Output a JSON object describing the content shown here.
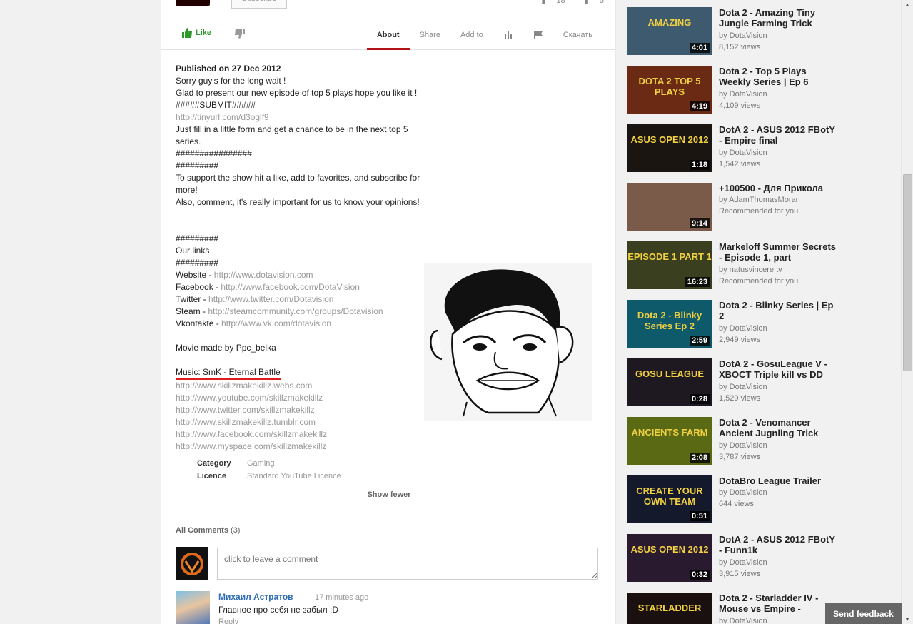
{
  "top": {
    "subscribe_label": "Subscribe",
    "likes_count": "18",
    "dislikes_count": "5"
  },
  "actions": {
    "like_label": "Like",
    "tabs": [
      {
        "label": "About",
        "active": true
      },
      {
        "label": "Share"
      },
      {
        "label": "Add to"
      },
      {
        "icon": "stats-icon"
      },
      {
        "icon": "flag-icon"
      },
      {
        "label": "Скачать"
      }
    ]
  },
  "description": {
    "published": "Published on 27 Dec 2012",
    "lines": [
      {
        "text": "Sorry guy's for the long wait !"
      },
      {
        "text": "Glad to present our new episode of top 5 plays hope you like it !"
      },
      {
        "text": "#####SUBMIT#####"
      },
      {
        "link": "http://tinyurl.com/d3oglf9"
      },
      {
        "text": "Just fill in a little form and get a chance to be in the next top 5"
      },
      {
        "text": "series."
      },
      {
        "text": "################"
      },
      {
        "text": "#########"
      },
      {
        "text": "To support the show hit a like, add to favorites, and subscribe for"
      },
      {
        "text": "more!"
      },
      {
        "text": "Also, comment, it's really important for us to know your opinions!"
      }
    ],
    "hashes_top": "#########",
    "our_links": "Our links",
    "hashes_bottom": "#########",
    "links": [
      {
        "label": "Website - ",
        "url": "http://www.dotavision.com"
      },
      {
        "label": "Facebook - ",
        "url": "http://www.facebook.com/DotaVision"
      },
      {
        "label": "Twitter - ",
        "url": "http://www.twitter.com/Dotavision"
      },
      {
        "label": "Steam - ",
        "url": "http://steamcommunity.com/groups/Dotavision"
      },
      {
        "label": "Vkontakte - ",
        "url": "http://www.vk.com/dotavision"
      }
    ],
    "movie_by": "Movie made by Ppc_belka",
    "music": "Music: SmK - Eternal Battle",
    "music_links": [
      "http://www.skillzmakekillz.webs.com",
      "http://www.youtube.com/skillzmakekillz",
      "http://www.twitter.com/skillzmakekillz",
      "http://www.skillzmakekillz.tumblr.com",
      "http://www.facebook.com/skillzmakekillz",
      "http://www.myspace.com/skillzmakekillz"
    ],
    "category_key": "Category",
    "category_val": "Gaming",
    "licence_key": "Licence",
    "licence_val": "Standard YouTube Licence",
    "show_fewer": "Show fewer"
  },
  "comments": {
    "header": "All Comments",
    "count": "(3)",
    "placeholder": "click to leave a comment",
    "first": {
      "author": "Михаил Астратов",
      "time": "17 minutes ago",
      "text": "Главное про себя не забыл :D",
      "reply": "Reply"
    }
  },
  "sidebar": [
    {
      "title": "Dota 2 - Amazing Tiny Jungle Farming Trick",
      "by": "by DotaVision",
      "meta": "8,152 views",
      "duration": "4:01",
      "thumb_text": "AMAZING",
      "bg": "#3d5a6e"
    },
    {
      "title": "Dota 2 - Top 5 Plays Weekly Series | Ep 6",
      "by": "by DotaVision",
      "meta": "4,109 views",
      "duration": "4:19",
      "thumb_text": "DOTA 2 TOP 5 PLAYS",
      "bg": "#6b2a14"
    },
    {
      "title": "DotA 2 - ASUS 2012 FBotY - Empire final",
      "by": "by DotaVision",
      "meta": "1,542 views",
      "duration": "1:18",
      "thumb_text": "ASUS OPEN 2012",
      "bg": "#1b1512"
    },
    {
      "title": "+100500 - Для Прикола",
      "by": "by AdamThomasMoran",
      "meta": "Recommended for you",
      "duration": "9:14",
      "thumb_text": "",
      "bg": "#7a5a48"
    },
    {
      "title": "Markeloff Summer Secrets - Episode 1, part",
      "by": "by natusvincere tv",
      "meta": "Recommended for you",
      "duration": "16:23",
      "thumb_text": "EPISODE 1 PART 1",
      "bg": "#3a3f20"
    },
    {
      "title": "Dota 2 - Blinky Series | Ep 2",
      "by": "by DotaVision",
      "meta": "2,949 views",
      "duration": "2:59",
      "thumb_text": "Dota 2 - Blinky Series Ep 2",
      "bg": "#0f5a6a"
    },
    {
      "title": "DotA 2 - GosuLeague V - XBOCT Triple kill vs DD",
      "by": "by DotaVision",
      "meta": "1,529 views",
      "duration": "0:28",
      "thumb_text": "GOSU LEAGUE",
      "bg": "#1e1820"
    },
    {
      "title": "Dota 2 - Venomancer Ancient Jugnling Trick",
      "by": "by DotaVision",
      "meta": "3,787 views",
      "duration": "2:08",
      "thumb_text": "ANCIENTS FARM",
      "bg": "#5a6a14"
    },
    {
      "title": "DotaBro League Trailer",
      "by": "by DotaVision",
      "meta": "644 views",
      "duration": "0:51",
      "thumb_text": "CREATE YOUR OWN TEAM",
      "bg": "#15192c"
    },
    {
      "title": "DotA 2 - ASUS 2012 FBotY - Funn1k",
      "by": "by DotaVision",
      "meta": "3,915 views",
      "duration": "0:32",
      "thumb_text": "ASUS OPEN 2012",
      "bg": "#2a1a30"
    },
    {
      "title": "Dota 2 - Starladder IV - Mouse vs Empire -",
      "by": "by DotaVision",
      "meta": "",
      "duration": "",
      "thumb_text": "STARLADDER",
      "bg": "#1a1010"
    }
  ],
  "feedback_label": "Send feedback"
}
